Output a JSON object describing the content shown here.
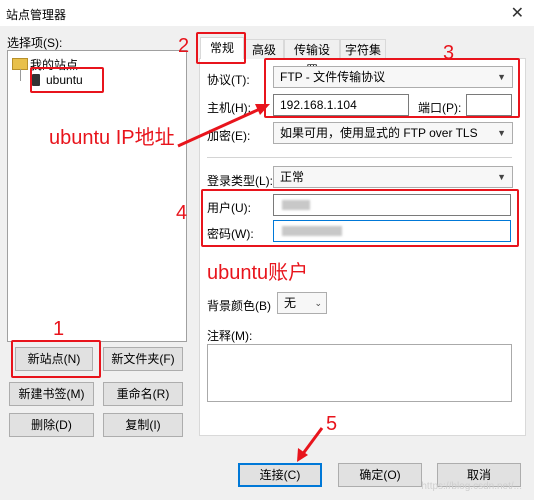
{
  "window": {
    "title": "站点管理器",
    "close_glyph": "✕"
  },
  "left": {
    "select_label": "选择项(S):",
    "tree": {
      "root": "我的站点",
      "child": "ubuntu"
    },
    "buttons": {
      "new_site": "新站点(N)",
      "new_folder": "新文件夹(F)",
      "new_bookmark": "新建书签(M)",
      "rename": "重命名(R)",
      "delete": "删除(D)",
      "copy": "复制(I)"
    }
  },
  "tabs": [
    "常规",
    "高级",
    "传输设置",
    "字符集"
  ],
  "general": {
    "protocol_label": "协议(T):",
    "protocol_value": "FTP - 文件传输协议",
    "host_label": "主机(H):",
    "host_value": "192.168.1.104",
    "port_label": "端口(P):",
    "port_value": "",
    "encryption_label": "加密(E):",
    "encryption_value": "如果可用，使用显式的 FTP over TLS",
    "logon_label": "登录类型(L):",
    "logon_value": "正常",
    "user_label": "用户(U):",
    "password_label": "密码(W):",
    "bgcolor_label": "背景颜色(B)",
    "bgcolor_value": "无",
    "comments_label": "注释(M):"
  },
  "footer": {
    "connect": "连接(C)",
    "ok": "确定(O)",
    "cancel": "取消"
  },
  "annotations": {
    "n1": "1",
    "n2": "2",
    "n3": "3",
    "n4": "4",
    "n5": "5",
    "ip_note": "ubuntu IP地址",
    "account_note": "ubuntu账户"
  },
  "watermark": "https://blog.csdn.net/...",
  "colors": {
    "annotation_red": "#e8141c",
    "focus_blue": "#0078d7"
  }
}
